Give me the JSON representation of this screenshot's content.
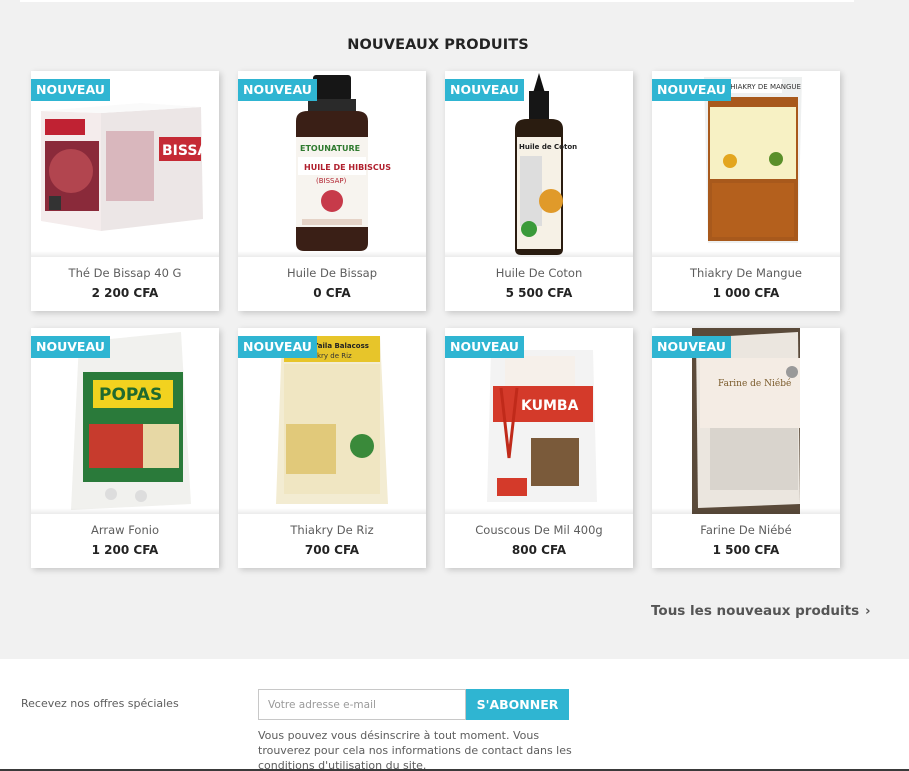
{
  "section": {
    "title": "NOUVEAUX PRODUITS"
  },
  "badge_label": "NOUVEAU",
  "products": [
    {
      "name": "Thé De Bissap 40 G",
      "price": "2 200 CFA",
      "image": "bissap-tea-box"
    },
    {
      "name": "Huile De Bissap",
      "price": "0 CFA",
      "image": "hibiscus-oil-bottle"
    },
    {
      "name": "Huile De Coton",
      "price": "5 500 CFA",
      "image": "cotton-oil-bottle"
    },
    {
      "name": "Thiakry De Mangue",
      "price": "1 000 CFA",
      "image": "mango-thiakry-bag"
    },
    {
      "name": "Arraw Fonio",
      "price": "1 200 CFA",
      "image": "popas-bag"
    },
    {
      "name": "Thiakry De Riz",
      "price": "700 CFA",
      "image": "rice-thiakry-bag"
    },
    {
      "name": "Couscous De Mil 400g",
      "price": "800 CFA",
      "image": "kumba-couscous-bag"
    },
    {
      "name": "Farine De Niébé",
      "price": "1 500 CFA",
      "image": "niebe-flour-bag"
    }
  ],
  "all_products_link": "Tous les nouveaux produits",
  "newsletter": {
    "label": "Recevez nos offres spéciales",
    "placeholder": "Votre adresse e-mail",
    "button": "S'ABONNER",
    "info": "Vous pouvez vous désinscrire à tout moment. Vous trouverez pour cela nos informations de contact dans les conditions d'utilisation du site."
  },
  "colors": {
    "accent": "#2fb5d2",
    "background": "#f1f1f1",
    "text": "#232323"
  }
}
